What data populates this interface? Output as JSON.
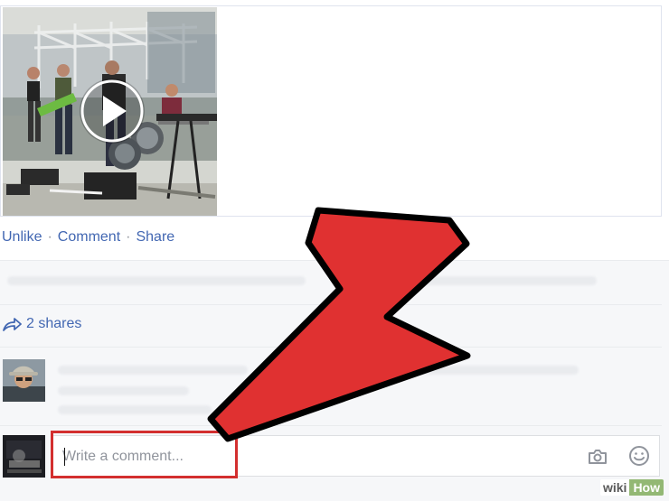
{
  "post": {
    "actions": {
      "unlike": "Unlike",
      "comment": "Comment",
      "share": "Share",
      "separator": "·"
    },
    "shares_text": "2 shares"
  },
  "comment_box": {
    "placeholder": "Write a comment..."
  },
  "icons": {
    "play": "play-icon",
    "share": "share-arrow-icon",
    "camera": "camera-icon",
    "emoji": "emoji-icon"
  },
  "annotation": {
    "highlight_color": "#d32f2f",
    "arrow_color": "#e03131"
  },
  "watermark": {
    "wiki": "wiki",
    "how": "How",
    "accent_color": "#93b874"
  },
  "colors": {
    "link": "#4267b2",
    "feedback_bg": "#f6f7f9",
    "border": "#dddfe2"
  }
}
